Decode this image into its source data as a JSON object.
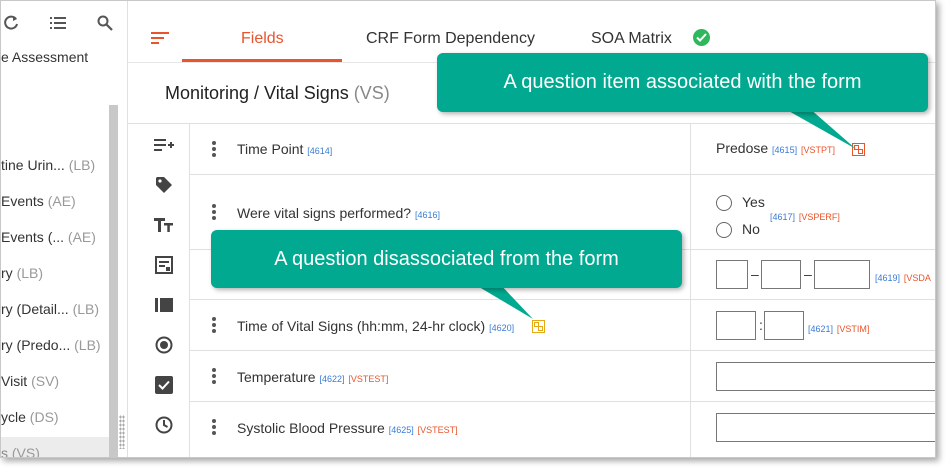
{
  "sidebar": {
    "items": [
      {
        "label": "e Assessment",
        "code": ""
      },
      {
        "label": "tine Urin...",
        "code": "(LB)"
      },
      {
        "label": "Events",
        "code": "(AE)"
      },
      {
        "label": "Events (...",
        "code": "(AE)"
      },
      {
        "label": "ry",
        "code": "(LB)"
      },
      {
        "label": "ry (Detail...",
        "code": "(LB)"
      },
      {
        "label": "ry (Predo...",
        "code": "(LB)"
      },
      {
        "label": "Visit",
        "code": "(SV)"
      },
      {
        "label": "ycle",
        "code": "(DS)"
      },
      {
        "label": "s",
        "code": "(VS)"
      }
    ]
  },
  "tabs": [
    {
      "label": "Fields",
      "active": true
    },
    {
      "label": "CRF Form Dependency",
      "active": false
    },
    {
      "label": "SOA Matrix",
      "active": false
    }
  ],
  "page": {
    "title": "Monitoring / Vital Signs",
    "abbr": "(VS)"
  },
  "rows": [
    {
      "question": "Time Point",
      "id": "[4614]",
      "var": "",
      "answer_label": "Predose",
      "answer_id": "[4615]",
      "answer_var": "[VSTPT]"
    },
    {
      "question": "Were vital signs performed?",
      "id": "[4616]",
      "var": "",
      "options": [
        "Yes",
        "No"
      ],
      "answer_id": "[4617]",
      "answer_var": "[VSPERF]"
    },
    {
      "question": "",
      "id": "",
      "var": "",
      "answer_id": "[4619]",
      "answer_var": "[VSDA",
      "separator": "–"
    },
    {
      "question": "Time of Vital Signs (hh:mm, 24-hr clock)",
      "id": "[4620]",
      "var": "",
      "answer_id": "[4621]",
      "answer_var": "[VSTIM]",
      "separator": ":"
    },
    {
      "question": "Temperature",
      "id": "[4622]",
      "var": "[VSTEST]"
    },
    {
      "question": "Systolic Blood Pressure",
      "id": "[4625]",
      "var": "[VSTEST]"
    }
  ],
  "callouts": {
    "associated": "A question item associated with the form",
    "disassociated": "A question disassociated from the form"
  },
  "colors": {
    "accent": "#e8542b",
    "callout": "#00a98f",
    "id_blue": "#3a7bd5",
    "check_green": "#2eb85c"
  },
  "icons": [
    "refresh-icon",
    "list-icon",
    "search-icon",
    "filter-menu-icon",
    "check-circle-icon",
    "add-field-icon",
    "tag-icon",
    "text-size-icon",
    "form-icon",
    "block-icon",
    "radio-icon",
    "checkbox-icon",
    "clock-icon",
    "drag-handle-icon",
    "link-icon"
  ]
}
